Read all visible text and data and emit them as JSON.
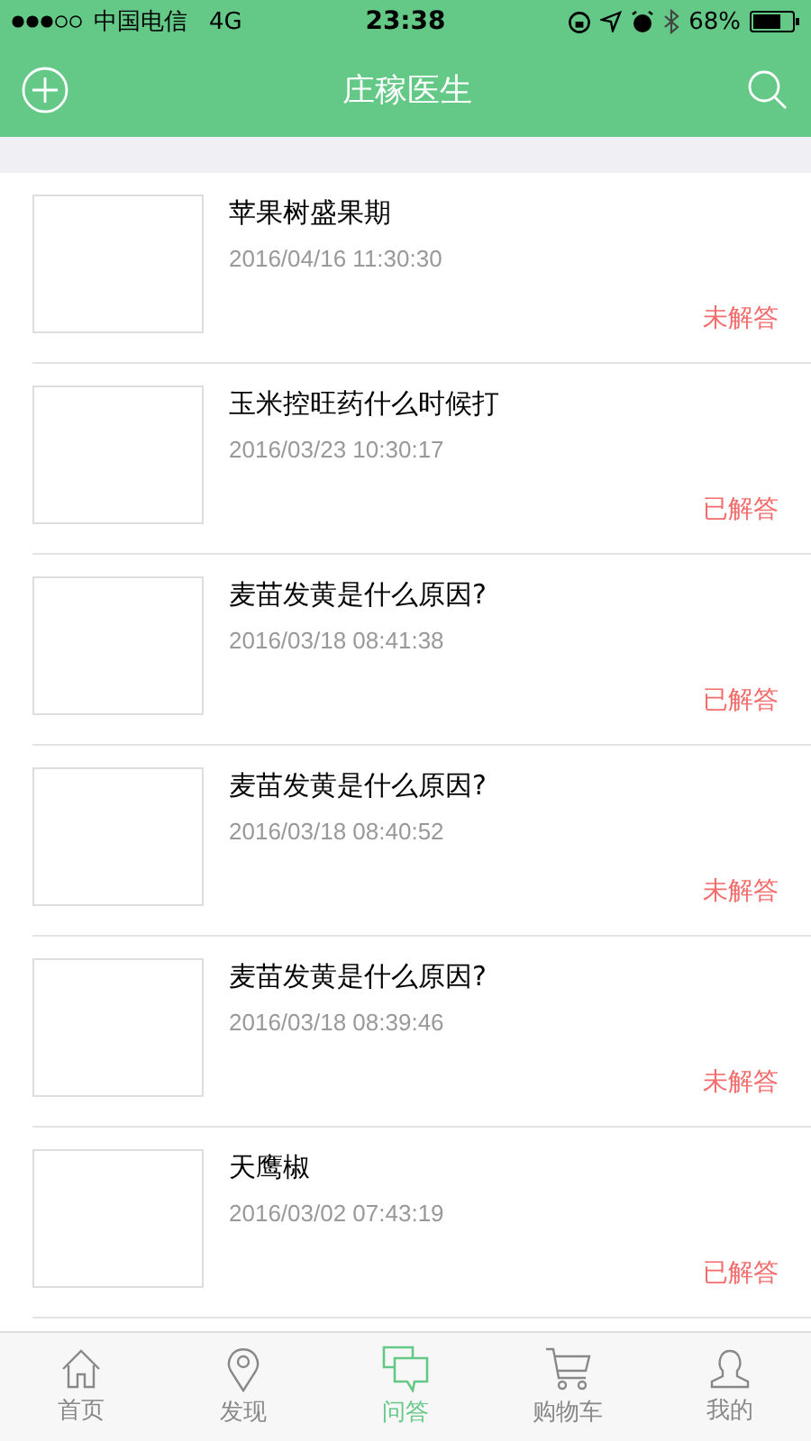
{
  "status_bar": {
    "carrier": "中国电信",
    "network": "4G",
    "time": "23:38",
    "battery": "68%"
  },
  "nav": {
    "title": "庄稼医生"
  },
  "questions": [
    {
      "title": "苹果树盛果期",
      "time": "2016/04/16 11:30:30",
      "status": "未解答"
    },
    {
      "title": "玉米控旺药什么时候打",
      "time": "2016/03/23 10:30:17",
      "status": "已解答"
    },
    {
      "title": "麦苗发黄是什么原因?",
      "time": "2016/03/18 08:41:38",
      "status": "已解答"
    },
    {
      "title": "麦苗发黄是什么原因?",
      "time": "2016/03/18 08:40:52",
      "status": "未解答"
    },
    {
      "title": "麦苗发黄是什么原因?",
      "time": "2016/03/18 08:39:46",
      "status": "未解答"
    },
    {
      "title": "天鹰椒",
      "time": "2016/03/02 07:43:19",
      "status": "已解答"
    }
  ],
  "tabs": [
    {
      "kind": "home",
      "label": "首页",
      "selected": false
    },
    {
      "kind": "discover",
      "label": "发现",
      "selected": false
    },
    {
      "kind": "qa",
      "label": "问答",
      "selected": true
    },
    {
      "kind": "cart",
      "label": "购物车",
      "selected": false
    },
    {
      "kind": "me",
      "label": "我的",
      "selected": false
    }
  ]
}
